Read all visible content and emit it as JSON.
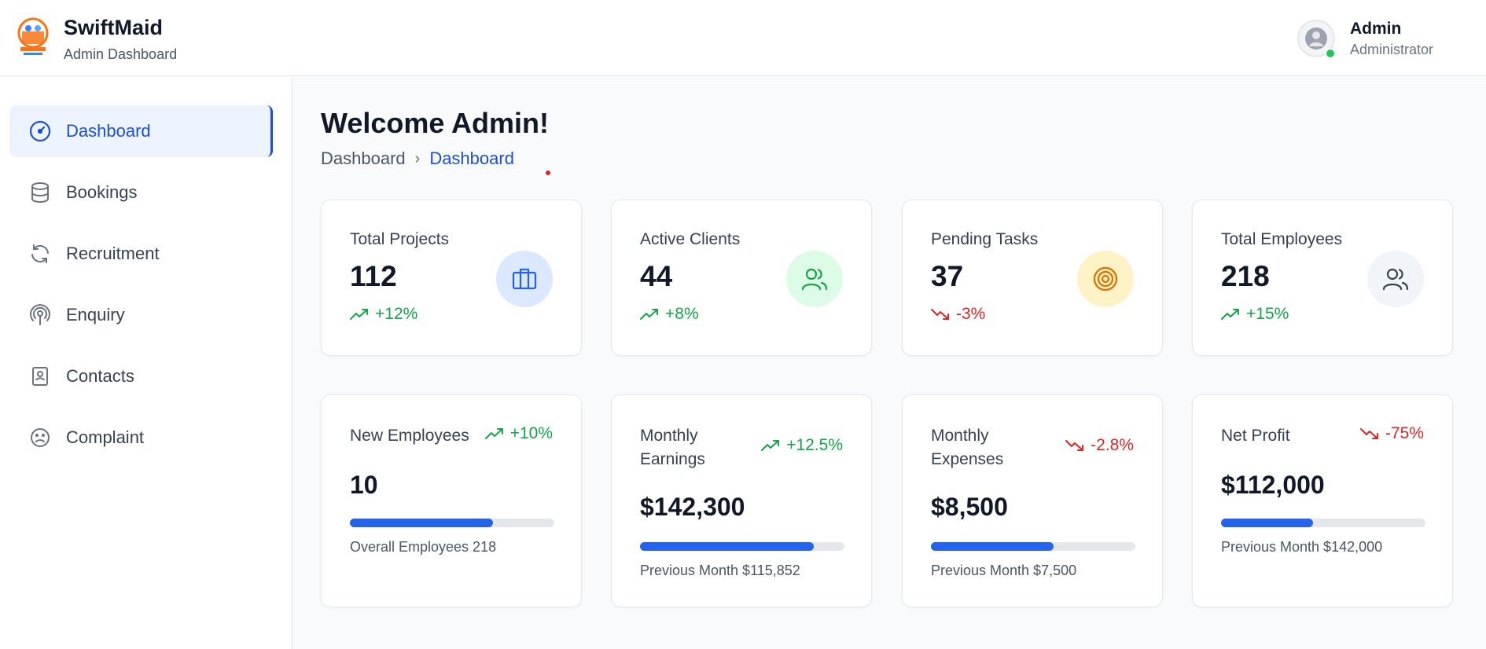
{
  "header": {
    "brand_name": "SwiftMaid",
    "brand_subtitle": "Admin Dashboard",
    "user_name": "Admin",
    "user_role": "Administrator"
  },
  "sidebar": {
    "items": [
      {
        "label": "Dashboard",
        "icon": "gauge-icon",
        "active": true
      },
      {
        "label": "Bookings",
        "icon": "database-icon"
      },
      {
        "label": "Recruitment",
        "icon": "refresh-icon"
      },
      {
        "label": "Enquiry",
        "icon": "broadcast-icon"
      },
      {
        "label": "Contacts",
        "icon": "contact-book-icon"
      },
      {
        "label": "Complaint",
        "icon": "sad-face-icon"
      }
    ]
  },
  "main": {
    "title": "Welcome Admin!",
    "breadcrumb": [
      "Dashboard",
      "Dashboard"
    ],
    "stats": [
      {
        "title": "Total Projects",
        "value": "112",
        "trend": "+12%",
        "direction": "up",
        "icon": "briefcase-icon",
        "icon_bg": "#dbe8fd",
        "icon_color": "#2563eb"
      },
      {
        "title": "Active Clients",
        "value": "44",
        "trend": "+8%",
        "direction": "up",
        "icon": "users-icon",
        "icon_bg": "#dcfce7",
        "icon_color": "#16a34a"
      },
      {
        "title": "Pending Tasks",
        "value": "37",
        "trend": "-3%",
        "direction": "down",
        "icon": "target-icon",
        "icon_bg": "#fef3c7",
        "icon_color": "#d97706"
      },
      {
        "title": "Total Employees",
        "value": "218",
        "trend": "+15%",
        "direction": "up",
        "icon": "users-icon",
        "icon_bg": "#f1f5f9",
        "icon_color": "#374151"
      }
    ],
    "metrics": [
      {
        "title": "New Employees",
        "trend": "+10%",
        "direction": "up",
        "value": "10",
        "progress": 0.7,
        "footer": "Overall Employees 218"
      },
      {
        "title": "Monthly Earnings",
        "trend": "+12.5%",
        "direction": "up",
        "value": "$142,300",
        "progress": 0.85,
        "footer": "Previous Month $115,852"
      },
      {
        "title": "Monthly Expenses",
        "trend": "-2.8%",
        "direction": "down",
        "value": "$8,500",
        "progress": 0.6,
        "footer": "Previous Month $7,500"
      },
      {
        "title": "Net Profit",
        "trend": "-75%",
        "direction": "down",
        "value": "$112,000",
        "progress": 0.45,
        "footer": "Previous Month $142,000"
      }
    ]
  },
  "colors": {
    "accent": "#1d4ed8",
    "up": "#16a34a",
    "down": "#dc2626",
    "progress": "#2563eb"
  }
}
